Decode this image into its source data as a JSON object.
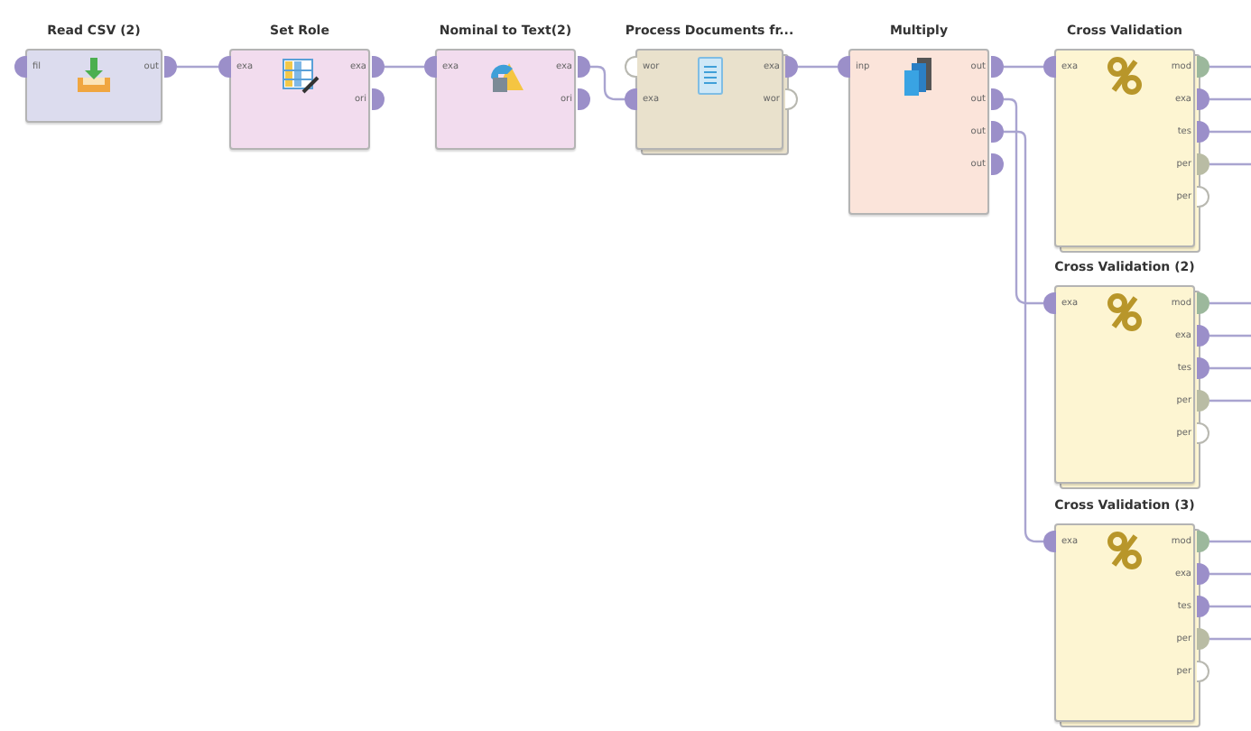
{
  "process": {
    "operators": [
      {
        "title": "Read CSV (2)",
        "kind": "read-csv",
        "color": "#dcdcee",
        "stacked": false,
        "inputs": [
          {
            "label": "fil",
            "filled": true,
            "color": "#9b8fc9"
          }
        ],
        "outputs": [
          {
            "label": "out",
            "filled": true,
            "color": "#9b8fc9"
          }
        ]
      },
      {
        "title": "Set Role",
        "kind": "set-role",
        "color": "#f2dcee",
        "stacked": false,
        "inputs": [
          {
            "label": "exa",
            "filled": true,
            "color": "#9b8fc9"
          }
        ],
        "outputs": [
          {
            "label": "exa",
            "filled": true,
            "color": "#9b8fc9"
          },
          {
            "label": "ori",
            "filled": true,
            "color": "#9b8fc9"
          }
        ]
      },
      {
        "title": "Nominal to Text(2)",
        "kind": "nominal-to-text",
        "color": "#f2dcee",
        "stacked": false,
        "inputs": [
          {
            "label": "exa",
            "filled": true,
            "color": "#9b8fc9"
          }
        ],
        "outputs": [
          {
            "label": "exa",
            "filled": true,
            "color": "#9b8fc9"
          },
          {
            "label": "ori",
            "filled": true,
            "color": "#9b8fc9"
          }
        ]
      },
      {
        "title": "Process Documents fr...",
        "kind": "process-documents",
        "color": "#e9e1cc",
        "stacked": true,
        "inputs": [
          {
            "label": "wor",
            "filled": false,
            "color": "#b8b8b0"
          },
          {
            "label": "exa",
            "filled": true,
            "color": "#9b8fc9"
          }
        ],
        "outputs": [
          {
            "label": "exa",
            "filled": true,
            "color": "#9b8fc9"
          },
          {
            "label": "wor",
            "filled": false,
            "color": "#b8b8b0"
          }
        ]
      },
      {
        "title": "Multiply",
        "kind": "multiply",
        "color": "#fbe4da",
        "stacked": false,
        "inputs": [
          {
            "label": "inp",
            "filled": true,
            "color": "#9b8fc9"
          }
        ],
        "outputs": [
          {
            "label": "out",
            "filled": true,
            "color": "#9b8fc9"
          },
          {
            "label": "out",
            "filled": true,
            "color": "#9b8fc9"
          },
          {
            "label": "out",
            "filled": true,
            "color": "#9b8fc9"
          },
          {
            "label": "out",
            "filled": true,
            "color": "#9b8fc9"
          }
        ]
      },
      {
        "title": "Cross Validation",
        "kind": "cross-validation",
        "color": "#fdf5d2",
        "stacked": true,
        "inputs": [
          {
            "label": "exa",
            "filled": true,
            "color": "#9b8fc9"
          }
        ],
        "outputs": [
          {
            "label": "mod",
            "filled": true,
            "color": "#9cb89c"
          },
          {
            "label": "exa",
            "filled": true,
            "color": "#9b8fc9"
          },
          {
            "label": "tes",
            "filled": true,
            "color": "#9b8fc9"
          },
          {
            "label": "per",
            "filled": true,
            "color": "#b9bca4"
          },
          {
            "label": "per",
            "filled": false,
            "color": "#b8b8b0"
          }
        ]
      },
      {
        "title": "Cross Validation (2)",
        "kind": "cross-validation",
        "color": "#fdf5d2",
        "stacked": true,
        "inputs": [
          {
            "label": "exa",
            "filled": true,
            "color": "#9b8fc9"
          }
        ],
        "outputs": [
          {
            "label": "mod",
            "filled": true,
            "color": "#9cb89c"
          },
          {
            "label": "exa",
            "filled": true,
            "color": "#9b8fc9"
          },
          {
            "label": "tes",
            "filled": true,
            "color": "#9b8fc9"
          },
          {
            "label": "per",
            "filled": true,
            "color": "#b9bca4"
          },
          {
            "label": "per",
            "filled": false,
            "color": "#b8b8b0"
          }
        ]
      },
      {
        "title": "Cross Validation (3)",
        "kind": "cross-validation",
        "color": "#fdf5d2",
        "stacked": true,
        "inputs": [
          {
            "label": "exa",
            "filled": true,
            "color": "#9b8fc9"
          }
        ],
        "outputs": [
          {
            "label": "mod",
            "filled": true,
            "color": "#9cb89c"
          },
          {
            "label": "exa",
            "filled": true,
            "color": "#9b8fc9"
          },
          {
            "label": "tes",
            "filled": true,
            "color": "#9b8fc9"
          },
          {
            "label": "per",
            "filled": true,
            "color": "#b9bca4"
          },
          {
            "label": "per",
            "filled": false,
            "color": "#b8b8b0"
          }
        ]
      }
    ]
  }
}
